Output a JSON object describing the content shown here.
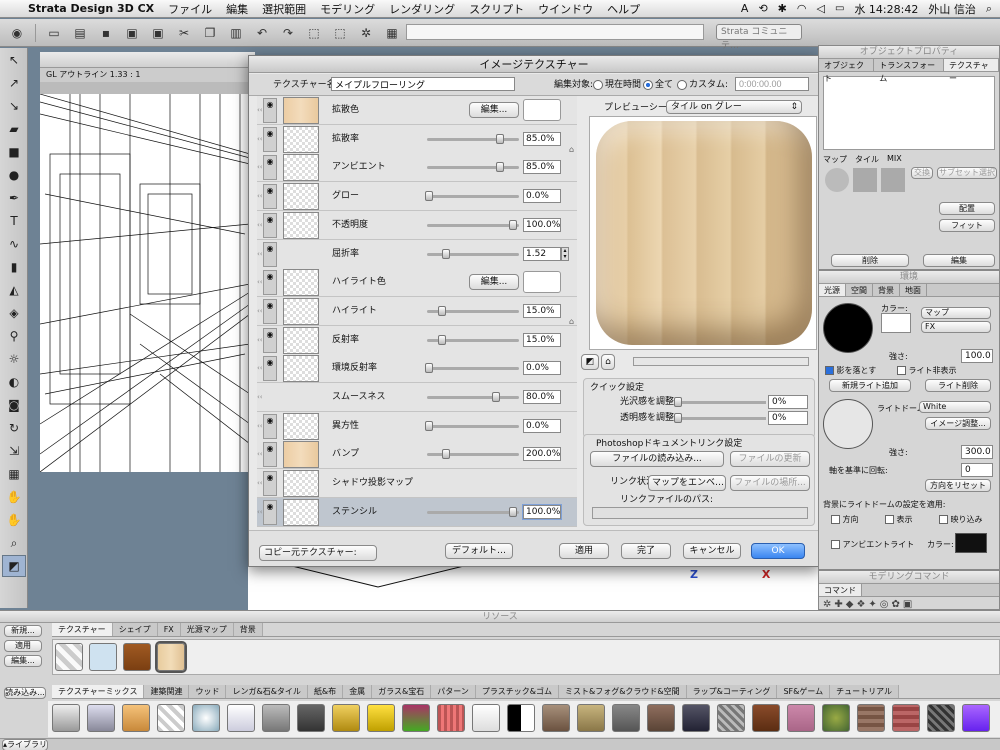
{
  "menubar": {
    "app_name": "Strata Design 3D CX",
    "items": [
      "ファイル",
      "編集",
      "選択範囲",
      "モデリング",
      "レンダリング",
      "スクリプト",
      "ウインドウ",
      "ヘルプ"
    ],
    "clock": "水 14:28:42",
    "user": "外山 信治"
  },
  "toolbar": {
    "community_dropdown": "Strata コミュニテ…"
  },
  "viewport": {
    "mode_label": "GL アウトライン",
    "scale": "1.33 : 1"
  },
  "dialog": {
    "title": "イメージテクスチャー",
    "texture_name_label": "テクスチャー名:",
    "texture_name_value": "メイプルフローリング",
    "edit_target_label": "編集対象:",
    "radio_current": "現在時間",
    "radio_all": "全て",
    "radio_custom": "カスタム:",
    "custom_time": "0:00:00.00",
    "preview_scene_label": "プレビューシーン:",
    "preview_scene_value": "タイル on グレー",
    "channels": [
      {
        "name": "拡散色",
        "type": "color",
        "button": "編集..."
      },
      {
        "name": "拡散率",
        "type": "slider",
        "value": "85.0%",
        "level": 0.85
      },
      {
        "name": "アンビエント",
        "type": "slider",
        "value": "85.0%",
        "level": 0.85
      },
      {
        "name": "グロー",
        "type": "slider",
        "value": "0.0%",
        "level": 0.0
      },
      {
        "name": "不透明度",
        "type": "slider",
        "value": "100.0%",
        "level": 1.0
      },
      {
        "name": "屈折率",
        "type": "slider",
        "value": "1.52",
        "level": 0.2
      },
      {
        "name": "ハイライト色",
        "type": "color",
        "button": "編集..."
      },
      {
        "name": "ハイライト",
        "type": "slider",
        "value": "15.0%",
        "level": 0.15
      },
      {
        "name": "反射率",
        "type": "slider",
        "value": "15.0%",
        "level": 0.15
      },
      {
        "name": "環境反射率",
        "type": "slider",
        "value": "0.0%",
        "level": 0.0
      },
      {
        "name": "スムースネス",
        "type": "slider",
        "value": "80.0%",
        "level": 0.8
      },
      {
        "name": "異方性",
        "type": "slider",
        "value": "0.0%",
        "level": 0.0
      },
      {
        "name": "バンプ",
        "type": "slider",
        "value": "200.0%",
        "level": 0.2
      },
      {
        "name": "シャドウ投影マップ",
        "type": "none"
      },
      {
        "name": "ステンシル",
        "type": "slider",
        "value": "100.0%",
        "level": 1.0
      }
    ],
    "quick_settings": {
      "label": "クイック設定",
      "gloss_label": "光沢感を調整",
      "gloss_value": "0%",
      "transparency_label": "透明感を調整",
      "transparency_value": "0%"
    },
    "photoshop": {
      "label": "Photoshopドキュメントリンク設定",
      "load_button": "ファイルの読み込み...",
      "update_button": "ファイルの更新",
      "link_status_label": "リンク状況:",
      "link_status_value": "マップをエンベ…",
      "locate_button": "ファイルの場所...",
      "link_path_label": "リンクファイルのパス:"
    },
    "copy_source": "コピー元テクスチャー:",
    "default_button": "デフォルト…",
    "apply_button": "適用",
    "done_button": "完了",
    "cancel_button": "キャンセル",
    "ok_button": "OK"
  },
  "object_properties": {
    "title": "オブジェクトプロパティ",
    "tabs": [
      "オブジェクト",
      "トランスフォーム",
      "テクスチャー"
    ],
    "sub_tabs": [
      "マップ",
      "タイル",
      "MIX"
    ],
    "exchange": "交換",
    "subset": "サブセット選択",
    "place_button": "配置",
    "fit_button": "フィット",
    "delete_button": "削除",
    "edit_button": "編集"
  },
  "environment": {
    "title": "環境",
    "tabs": [
      "光源",
      "空間",
      "背景",
      "地面"
    ],
    "color_label": "カラー:",
    "map_dropdown": "マップ",
    "fx_dropdown": "FX",
    "intensity_label": "強さ:",
    "intensity_value": "100.0",
    "cast_shadow": "影を落とす",
    "hide_light": "ライト非表示",
    "add_light": "新規ライト追加",
    "delete_light": "ライト削除",
    "light_dome_label": "ライトドーム:",
    "light_dome_value": "White",
    "image_adjust": "イメージ調整...",
    "intensity2_value": "300.0",
    "axis_rotation_label": "軸を基準に回転:",
    "axis_rotation_value": "0",
    "reset_direction": "方向をリセット",
    "bg_apply_label": "背景にライトドームの設定を適用:",
    "opt_direction": "方向",
    "opt_display": "表示",
    "opt_reflect": "映り込み",
    "ambient_label": "アンビエントライト",
    "ambient_color_label": "カラー:"
  },
  "command_panel": {
    "title": "モデリングコマンド",
    "tab": "コマンド"
  },
  "resources": {
    "title": "リソース",
    "side_buttons": [
      "新規...",
      "適用",
      "編集..."
    ],
    "tabs": [
      "テクスチャー",
      "シェイプ",
      "FX",
      "光源マップ",
      "背景"
    ],
    "load_button": "読み込み...",
    "library_tabs": [
      "テクスチャーミックス",
      "建築関連",
      "ウッド",
      "レンガ&石&タイル",
      "紙&布",
      "金属",
      "ガラス&宝石",
      "パターン",
      "プラスチック&ゴム",
      "ミスト&フォグ&クラウド&空間",
      "ラップ&コーティング",
      "SF&ゲーム",
      "チュートリアル"
    ],
    "library_label": "ライブラリ"
  },
  "axis_labels": {
    "z": "Z",
    "x": "X"
  },
  "colors": {
    "accent": "#3a86f0",
    "wood": "#e4caa0",
    "default_button": "#3a86f0"
  }
}
